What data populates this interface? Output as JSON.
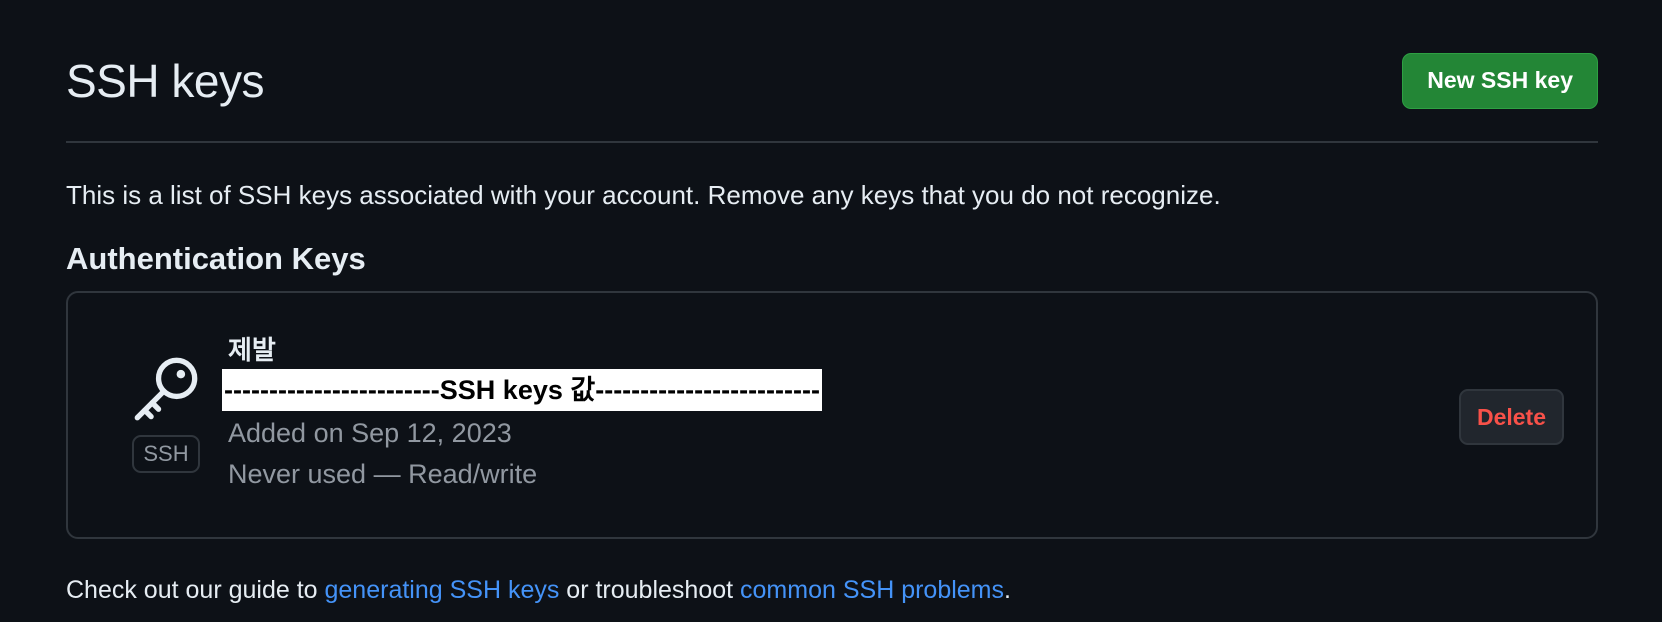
{
  "header": {
    "title": "SSH keys",
    "new_button_label": "New SSH key"
  },
  "intro_text": "This is a list of SSH keys associated with your account. Remove any keys that you do not recognize.",
  "section_title": "Authentication Keys",
  "keys": [
    {
      "title": "제발",
      "fingerprint": "------------------------SSH keys 값-------------------------",
      "badge": "SSH",
      "added": "Added on Sep 12, 2023",
      "usage": "Never used — Read/write",
      "delete_label": "Delete",
      "icon": "key-icon"
    }
  ],
  "footer": {
    "prefix": "Check out our guide to ",
    "link1": "generating SSH keys",
    "middle": " or troubleshoot ",
    "link2": "common SSH problems",
    "suffix": "."
  },
  "colors": {
    "background": "#0d1117",
    "primary_button": "#238636",
    "danger_text": "#f85149",
    "link": "#4493f8",
    "muted_text": "#9198a1",
    "border": "#30363d"
  }
}
